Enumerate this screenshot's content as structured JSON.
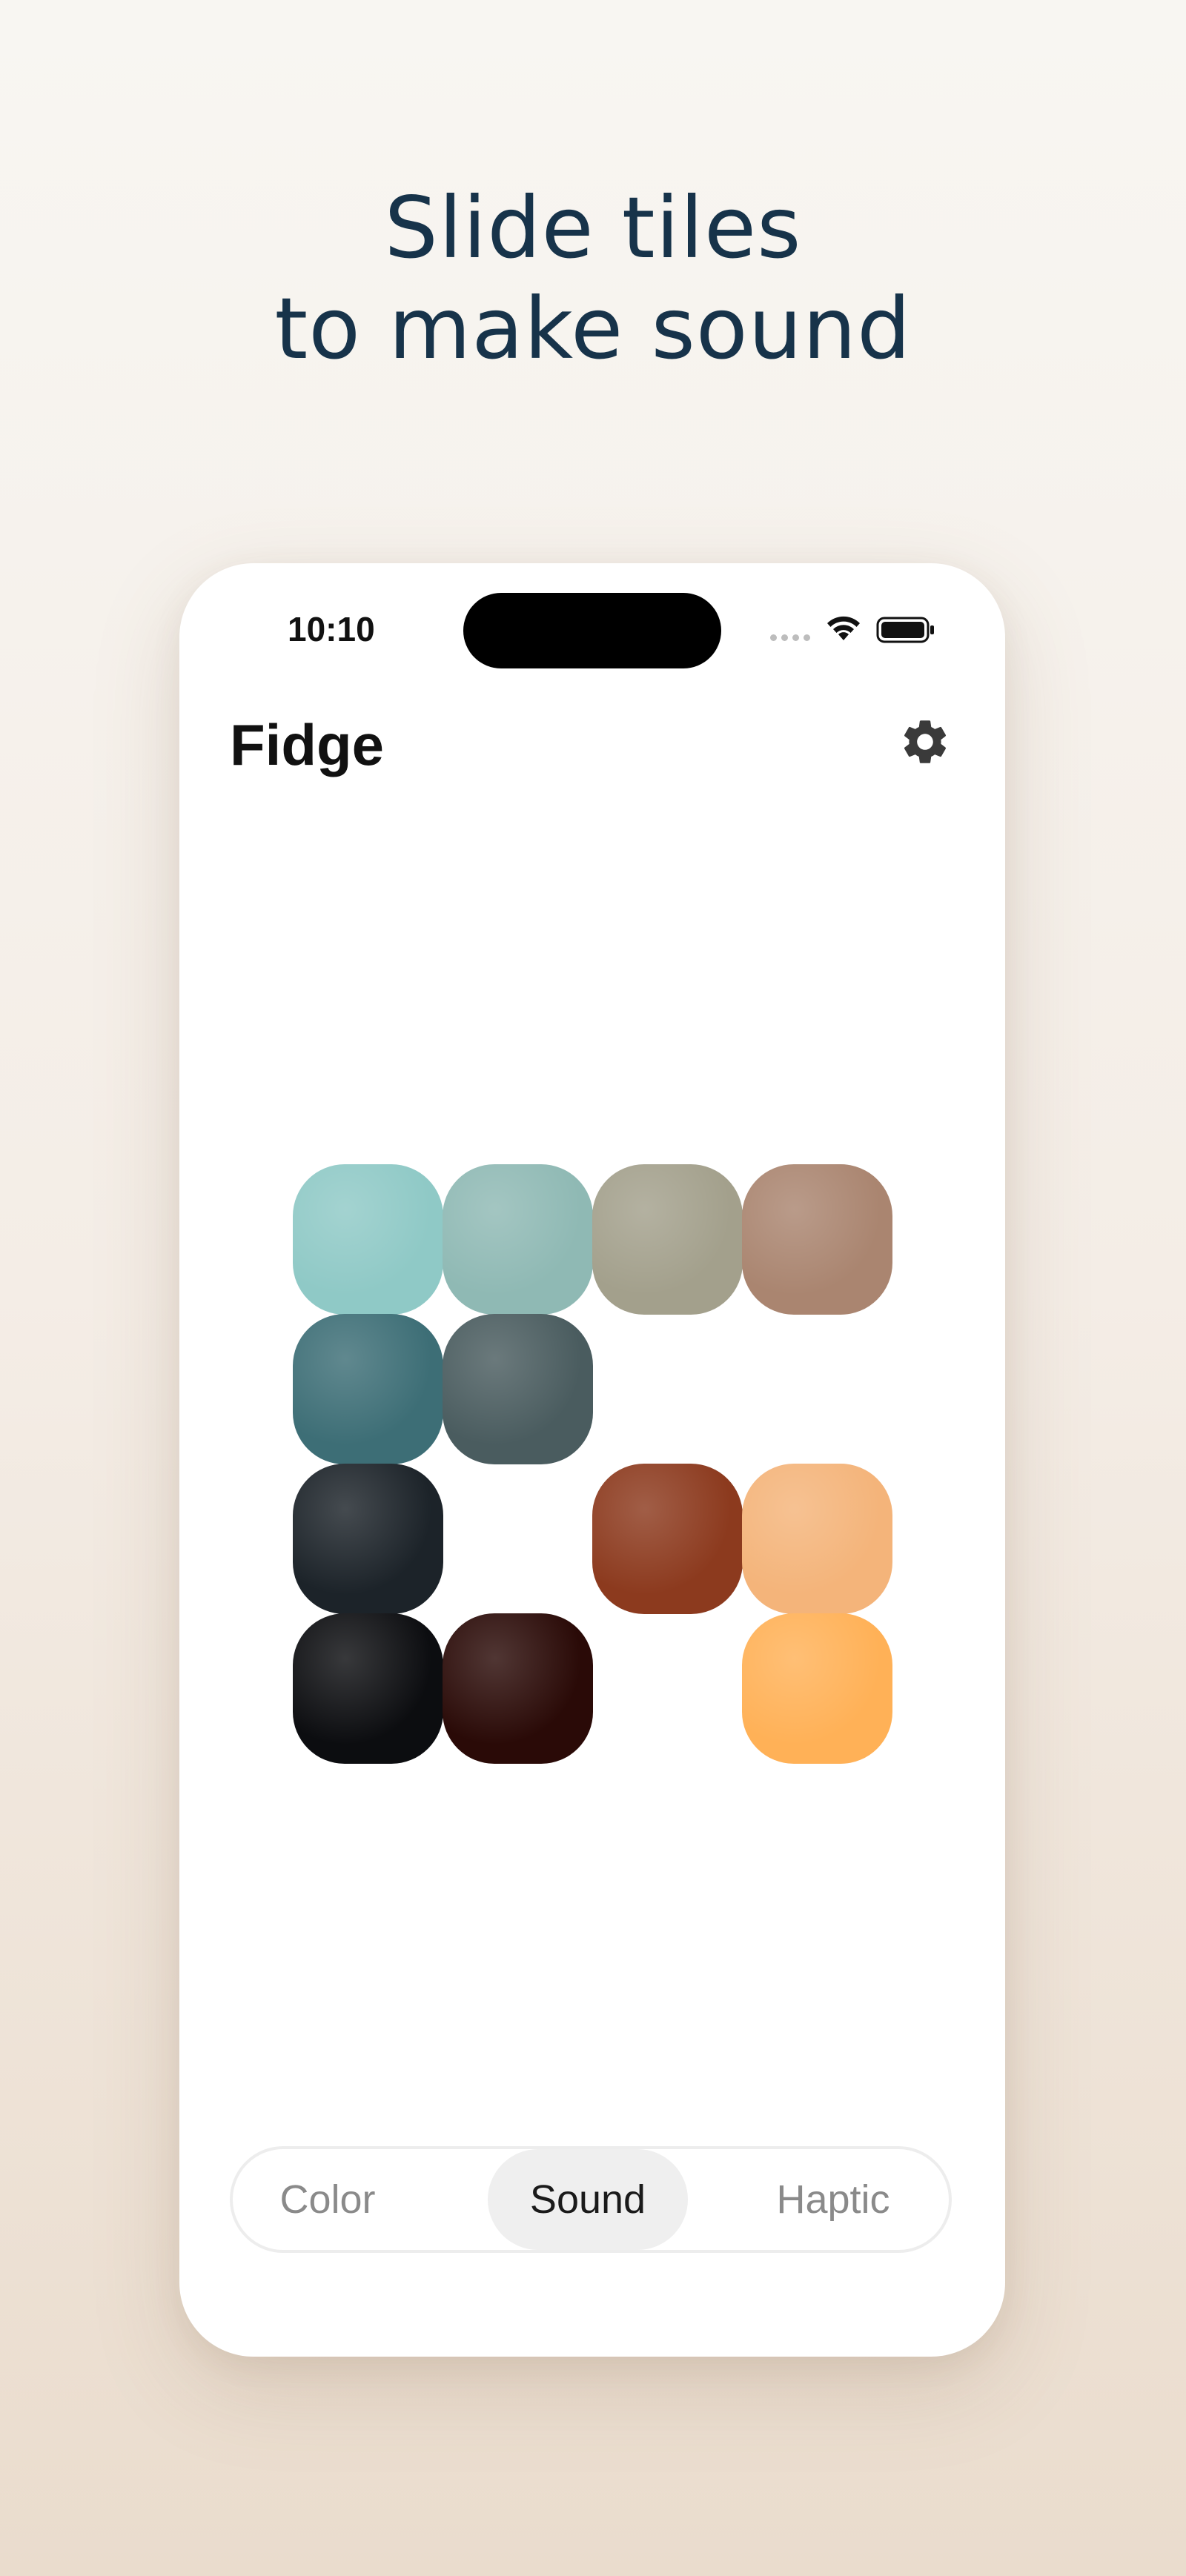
{
  "headline": {
    "line1": "Slide tiles",
    "line2": "to make sound"
  },
  "status_bar": {
    "time": "10:10"
  },
  "app": {
    "title": "Fidge"
  },
  "icons": {
    "settings": "gear-icon",
    "wifi": "wifi-icon",
    "battery": "battery-icon",
    "signal": "cellular-signal-icon"
  },
  "tiles": [
    {
      "row": 1,
      "col": 1,
      "color": "#8fc9c6"
    },
    {
      "row": 1,
      "col": 2,
      "color": "#8fb9b4"
    },
    {
      "row": 1,
      "col": 3,
      "color": "#a3a08c"
    },
    {
      "row": 1,
      "col": 4,
      "color": "#aa8570"
    },
    {
      "row": 2,
      "col": 1,
      "color": "#3d6e76"
    },
    {
      "row": 2,
      "col": 2,
      "color": "#4a5c5f"
    },
    {
      "row": 3,
      "col": 1,
      "color": "#1c2329"
    },
    {
      "row": 3,
      "col": 3,
      "color": "#8c3a1e"
    },
    {
      "row": 3,
      "col": 4,
      "color": "#f4b47a"
    },
    {
      "row": 4,
      "col": 1,
      "color": "#0c0d10"
    },
    {
      "row": 4,
      "col": 2,
      "color": "#2a0a07"
    },
    {
      "row": 4,
      "col": 4,
      "color": "#ffb157"
    }
  ],
  "mode_switcher": {
    "options": [
      "Color",
      "Sound",
      "Haptic"
    ],
    "selected": "Sound"
  },
  "colors": {
    "headline": "#17334a",
    "background_top": "#f8f6f2",
    "background_bottom": "#eadccd",
    "segment_active_bg": "#efefef"
  }
}
